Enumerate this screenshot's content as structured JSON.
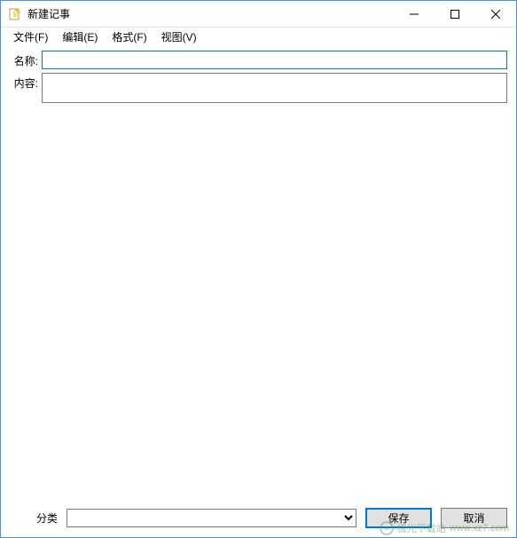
{
  "window": {
    "title": "新建记事"
  },
  "menubar": {
    "items": [
      {
        "label": "文件(F)"
      },
      {
        "label": "编辑(E)"
      },
      {
        "label": "格式(F)"
      },
      {
        "label": "视图(V)"
      }
    ]
  },
  "form": {
    "name_label": "名称:",
    "name_value": "",
    "content_label": "内容:",
    "content_value": ""
  },
  "bottom": {
    "category_label": "分类",
    "category_value": "",
    "save_label": "保存",
    "cancel_label": "取消"
  },
  "watermark": {
    "text1": "极光下载站",
    "text2": "www.xz7.com"
  }
}
